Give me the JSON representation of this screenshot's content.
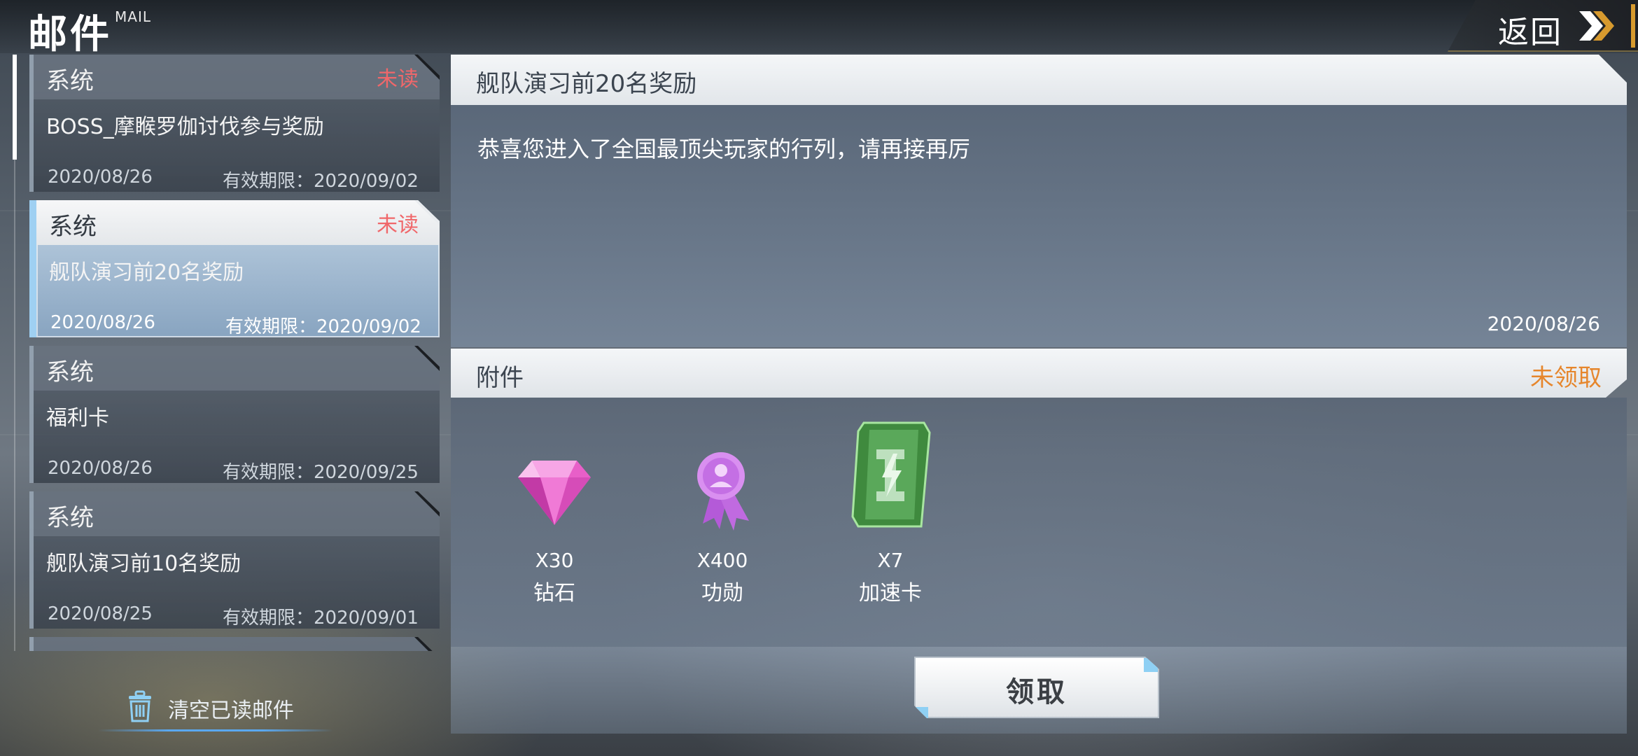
{
  "header": {
    "title": "邮件",
    "subtitle": "MAIL",
    "back_label": "返回"
  },
  "mail_list": [
    {
      "sender": "系统",
      "status": "未读",
      "subject": "BOSS_摩睺罗伽讨伐参与奖励",
      "date": "2020/08/26",
      "expire": "有效期限：2020/09/02"
    },
    {
      "sender": "系统",
      "status": "未读",
      "subject": "舰队演习前20名奖励",
      "date": "2020/08/26",
      "expire": "有效期限：2020/09/02"
    },
    {
      "sender": "系统",
      "status": "",
      "subject": "福利卡",
      "date": "2020/08/26",
      "expire": "有效期限：2020/09/25"
    },
    {
      "sender": "系统",
      "status": "",
      "subject": "舰队演习前10名奖励",
      "date": "2020/08/25",
      "expire": "有效期限：2020/09/01"
    },
    {
      "sender": "系统",
      "status": "",
      "subject": "",
      "date": "",
      "expire": ""
    }
  ],
  "clear_read_label": "清空已读邮件",
  "detail": {
    "title": "舰队演习前20名奖励",
    "body": "恭喜您进入了全国最顶尖玩家的行列，请再接再厉",
    "date": "2020/08/26",
    "attachments_label": "附件",
    "attachments_status": "未领取",
    "rewards": [
      {
        "count": "X30",
        "name": "钻石",
        "icon": "diamond-icon"
      },
      {
        "count": "X400",
        "name": "功勋",
        "icon": "medal-icon"
      },
      {
        "count": "X7",
        "name": "加速卡",
        "icon": "speedup-card-icon"
      }
    ],
    "claim_label": "领取"
  },
  "colors": {
    "unread": "#f0676a",
    "unclaimed": "#e6862c",
    "selected_accent": "#9fd0f2",
    "back_accent": "#d79a2e"
  }
}
